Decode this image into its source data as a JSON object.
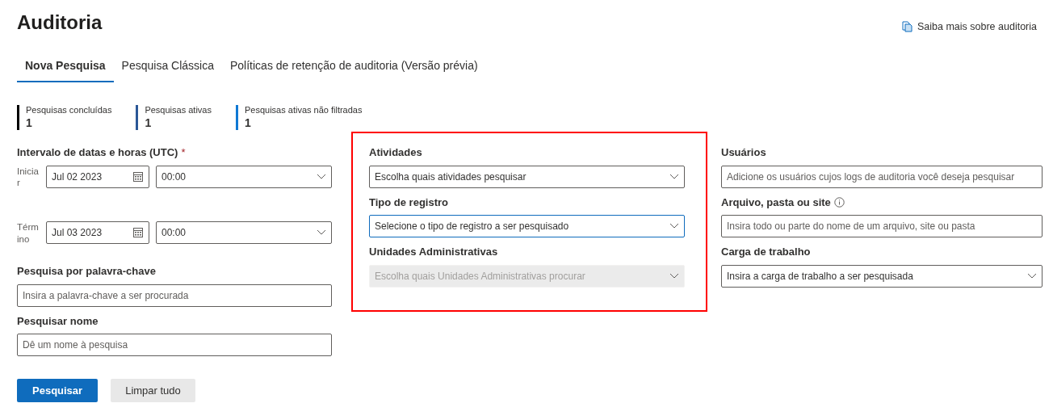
{
  "header": {
    "title": "Auditoria",
    "help_link": "Saiba mais sobre auditoria"
  },
  "tabs": [
    {
      "label": "Nova Pesquisa",
      "selected": true
    },
    {
      "label": "Pesquisa Clássica",
      "selected": false
    },
    {
      "label": "Políticas de retenção de auditoria (Versão prévia)",
      "selected": false
    }
  ],
  "stats": [
    {
      "label": "Pesquisas concluídas",
      "value": "1",
      "color": "#000000"
    },
    {
      "label": "Pesquisas ativas",
      "value": "1",
      "color": "#2b5797"
    },
    {
      "label": "Pesquisas ativas não filtradas",
      "value": "1",
      "color": "#0f78d4"
    }
  ],
  "date_range": {
    "label": "Intervalo de datas e horas (UTC)",
    "required_mark": "*",
    "rows": [
      {
        "label": "Iniciar",
        "date": "Jul 02 2023",
        "time": "00:00"
      },
      {
        "label": "Término",
        "date": "Jul 03 2023",
        "time": "00:00"
      }
    ]
  },
  "left_fields": [
    {
      "label": "Pesquisa por palavra-chave",
      "kind": "text",
      "placeholder": "Insira a palavra-chave a ser procurada"
    },
    {
      "label": "Pesquisar nome",
      "kind": "text",
      "placeholder": "Dê um nome à pesquisa"
    }
  ],
  "middle_panel": {
    "highlighted": true,
    "fields": [
      {
        "label": "Atividades",
        "kind": "select",
        "placeholder": "Escolha quais atividades pesquisar",
        "focused": false,
        "disabled": false
      },
      {
        "label": "Tipo de registro",
        "kind": "select",
        "placeholder": "Selecione o tipo de registro a ser pesquisado",
        "focused": true,
        "disabled": false
      },
      {
        "label": "Unidades Administrativas",
        "kind": "select",
        "placeholder": "Escolha quais Unidades Administrativas procurar",
        "focused": false,
        "disabled": true
      }
    ]
  },
  "right_fields": [
    {
      "label": "Usuários",
      "kind": "text",
      "placeholder": "Adicione os usuários cujos logs de auditoria você deseja pesquisar"
    },
    {
      "label": "Arquivo, pasta ou site",
      "kind": "text",
      "placeholder": "Insira todo ou parte do nome de um arquivo, site ou pasta",
      "info": true
    },
    {
      "label": "Carga de trabalho",
      "kind": "select",
      "placeholder": "Insira a carga de trabalho a ser pesquisada"
    }
  ],
  "buttons": [
    {
      "label": "Pesquisar",
      "kind": "primary"
    },
    {
      "label": "Limpar tudo",
      "kind": "secondary"
    }
  ]
}
